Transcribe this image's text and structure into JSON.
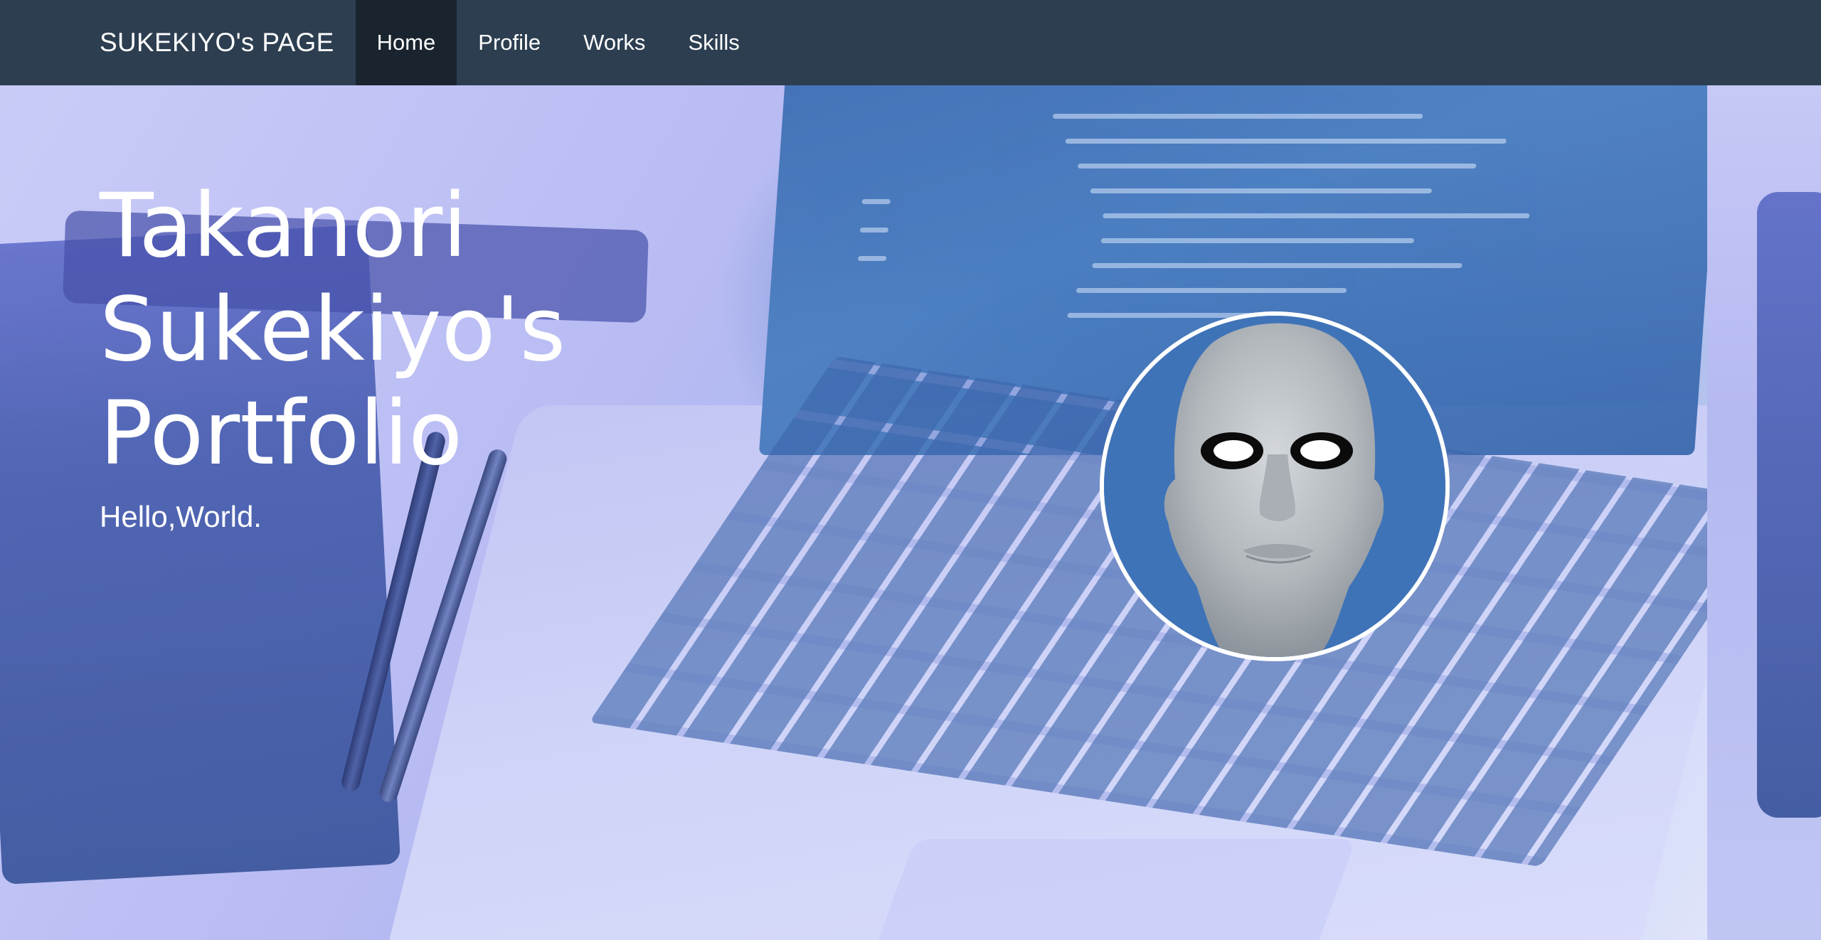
{
  "navbar": {
    "brand": "SUKEKIYO's PAGE",
    "items": [
      {
        "label": "Home",
        "active": true
      },
      {
        "label": "Profile",
        "active": false
      },
      {
        "label": "Works",
        "active": false
      },
      {
        "label": "Skills",
        "active": false
      }
    ]
  },
  "hero": {
    "title_lines": [
      "Takanori",
      "Sukekiyo's",
      "Portfolio"
    ],
    "subtitle": "Hello,World."
  },
  "colors": {
    "navbar_bg": "#2c3e50",
    "navbar_active_bg": "#1a242f",
    "text": "#ffffff"
  }
}
